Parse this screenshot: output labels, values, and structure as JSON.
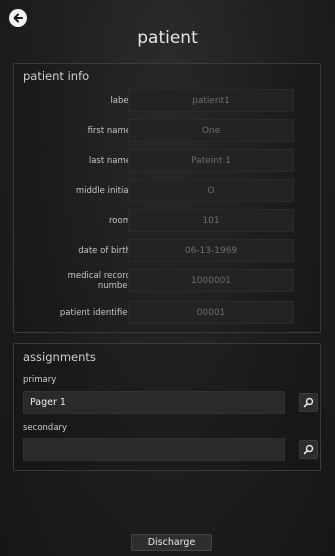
{
  "header": {
    "title": "patient"
  },
  "patient_info": {
    "section_title": "patient info",
    "fields": [
      {
        "label": "label",
        "value": "patient1"
      },
      {
        "label": "first name",
        "value": "One"
      },
      {
        "label": "last name",
        "value": "Pateint 1"
      },
      {
        "label": "middle initial",
        "value": "O"
      },
      {
        "label": "room",
        "value": "101"
      },
      {
        "label": "date of birth",
        "value": "06-13-1969"
      },
      {
        "label": "medical record number",
        "value": "1000001"
      },
      {
        "label": "patient identifier",
        "value": "00001"
      }
    ]
  },
  "assignments": {
    "section_title": "assignments",
    "primary_label": "primary",
    "primary_value": "Pager 1",
    "secondary_label": "secondary",
    "secondary_value": ""
  },
  "footer": {
    "discharge_label": "Discharge"
  },
  "icons": {
    "back": "back-arrow-icon",
    "search": "search-icon"
  }
}
